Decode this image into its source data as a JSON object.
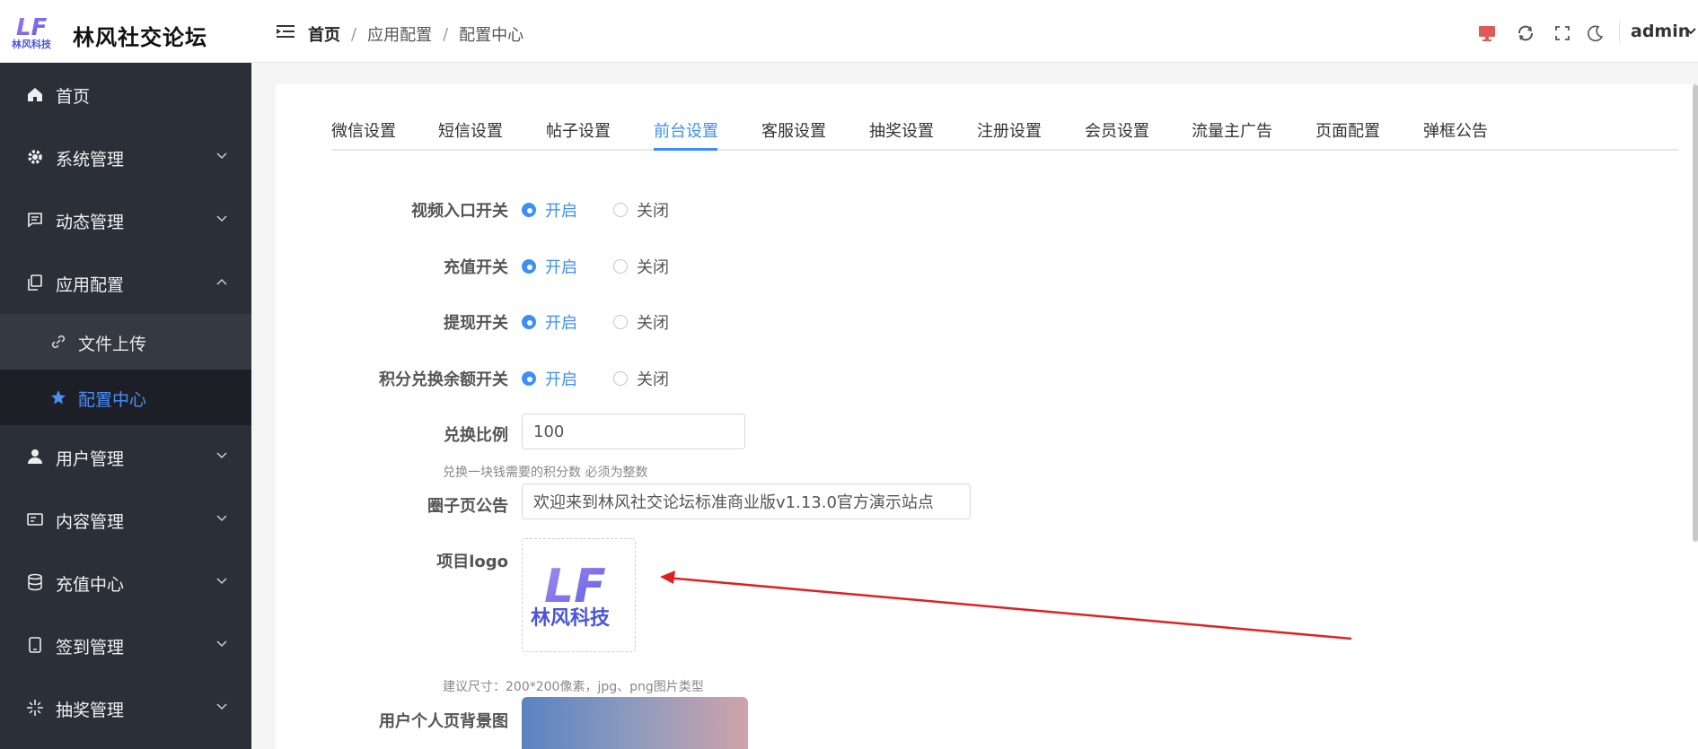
{
  "header": {
    "brand_name": "林风社交论坛",
    "logo_text": "林风科技",
    "logo_letters": "LF",
    "breadcrumb": [
      "首页",
      "应用配置",
      "配置中心"
    ],
    "breadcrumb_sep": "/",
    "user_name": "admin",
    "tool_icons": [
      "monitor-icon",
      "refresh-icon",
      "fullscreen-icon",
      "moon-icon"
    ]
  },
  "sidebar": {
    "items": [
      {
        "label": "首页",
        "icon": "home-icon"
      },
      {
        "label": "系统管理",
        "icon": "gear-icon"
      },
      {
        "label": "动态管理",
        "icon": "message-icon"
      },
      {
        "label": "应用配置",
        "icon": "copy-icon",
        "expanded": true
      },
      {
        "label": "用户管理",
        "icon": "user-icon"
      },
      {
        "label": "内容管理",
        "icon": "card-icon"
      },
      {
        "label": "充值中心",
        "icon": "database-icon"
      },
      {
        "label": "签到管理",
        "icon": "tablet-icon"
      },
      {
        "label": "抽奖管理",
        "icon": "sparkle-icon"
      }
    ],
    "submenu": [
      {
        "label": "文件上传",
        "icon": "link-icon"
      },
      {
        "label": "配置中心",
        "icon": "star-icon",
        "active": true
      }
    ]
  },
  "tabs": [
    "微信设置",
    "短信设置",
    "帖子设置",
    "前台设置",
    "客服设置",
    "抽奖设置",
    "注册设置",
    "会员设置",
    "流量主广告",
    "页面配置",
    "弹框公告"
  ],
  "active_tab": "前台设置",
  "form": {
    "switches": [
      {
        "label": "视频入口开关",
        "on": "开启",
        "off": "关闭",
        "value": "on"
      },
      {
        "label": "充值开关",
        "on": "开启",
        "off": "关闭",
        "value": "on"
      },
      {
        "label": "提现开关",
        "on": "开启",
        "off": "关闭",
        "value": "on"
      },
      {
        "label": "积分兑换余额开关",
        "on": "开启",
        "off": "关闭",
        "value": "on"
      }
    ],
    "ratio": {
      "label": "兑换比例",
      "value": "100",
      "hint": "兑换一块钱需要的积分数 必须为整数"
    },
    "notice": {
      "label": "圈子页公告",
      "value": "欢迎来到林风社交论坛标准商业版v1.13.0官方演示站点"
    },
    "logo": {
      "label": "项目logo",
      "image_text": "林风科技",
      "image_letters": "LF",
      "hint": "建议尺寸：200*200像素，jpg、png图片类型"
    },
    "bg": {
      "label": "用户个人页背景图"
    }
  },
  "colors": {
    "accent": "#3e8ef7",
    "sidebar_bg": "#2b3038",
    "annotation_arrow": "#e02020",
    "logo_purple": "#7b68ee"
  }
}
